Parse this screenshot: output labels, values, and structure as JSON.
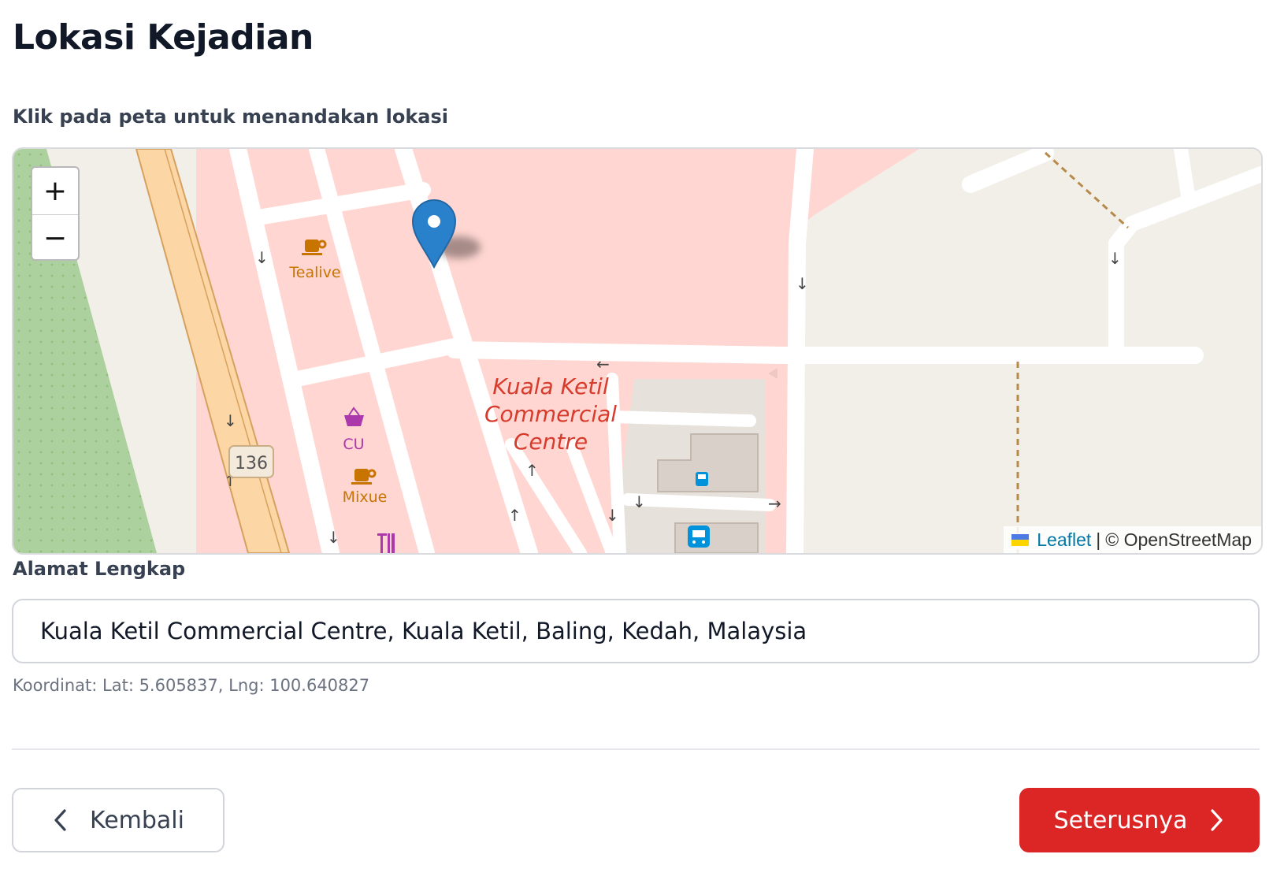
{
  "page": {
    "title": "Lokasi Kejadian",
    "map_hint": "Klik pada peta untuk menandakan lokasi"
  },
  "map": {
    "zoom_in": "+",
    "zoom_out": "−",
    "pois": {
      "tealive": "Tealive",
      "cu": "CU",
      "mixue": "Mixue",
      "area_line1": "Kuala Ketil",
      "area_line2": "Commercial",
      "area_line3": "Centre",
      "road_ref": "136"
    },
    "attribution": {
      "leaflet": "Leaflet",
      "separator": "|",
      "osm": "© OpenStreetMap"
    },
    "colors": {
      "commercial": "#ffd6d1",
      "background": "#f2efe9",
      "road": "#ffffff",
      "primary_road": "#fcd6a4",
      "park": "#add19e",
      "marker": "#2a81cb",
      "label_red": "#d63b2b",
      "poi_food": "#c77400",
      "poi_shop": "#ac39ac"
    }
  },
  "address": {
    "label": "Alamat Lengkap",
    "value": "Kuala Ketil Commercial Centre, Kuala Ketil, Baling, Kedah, Malaysia",
    "coordinates": "Koordinat: Lat: 5.605837, Lng: 100.640827"
  },
  "nav": {
    "back_label": "Kembali",
    "next_label": "Seterusnya",
    "accent": "#dc2626"
  }
}
